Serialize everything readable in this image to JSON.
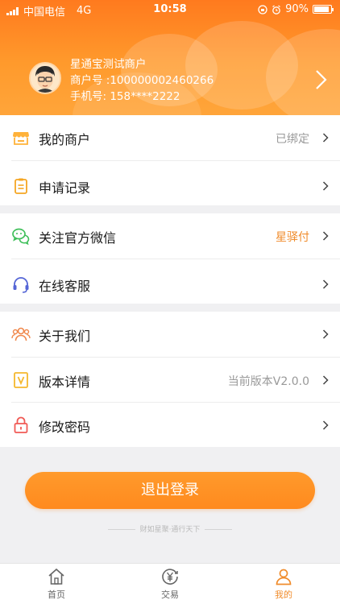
{
  "status_bar": {
    "carrier": "中国电信",
    "network": "4G",
    "time": "10:58",
    "battery": "90%",
    "battery_level": 0.9
  },
  "profile": {
    "name": "星通宝测试商户",
    "merchant_no": "商户号 :100000002460266",
    "phone": "手机号: 158****2222"
  },
  "menu": {
    "my_merchant": {
      "label": "我的商户",
      "value": "已绑定"
    },
    "apply_record": {
      "label": "申请记录"
    },
    "follow_wechat": {
      "label": "关注官方微信",
      "value": "星驿付"
    },
    "online_service": {
      "label": "在线客服"
    },
    "about_us": {
      "label": "关于我们"
    },
    "version": {
      "label": "版本详情",
      "value": "当前版本V2.0.0"
    },
    "change_password": {
      "label": "修改密码"
    }
  },
  "logout_label": "退出登录",
  "slogan": "财如星聚·通行天下",
  "tabs": [
    {
      "label": "首页",
      "icon": "home-icon"
    },
    {
      "label": "交易",
      "icon": "yuan-icon"
    },
    {
      "label": "我的",
      "icon": "user-icon"
    }
  ],
  "colors": {
    "accent": "#ff8c1e",
    "wechat_green": "#3fbf5a",
    "service_blue": "#5465d6",
    "password_red": "#f05a55",
    "value_orange": "#f08c2c"
  }
}
